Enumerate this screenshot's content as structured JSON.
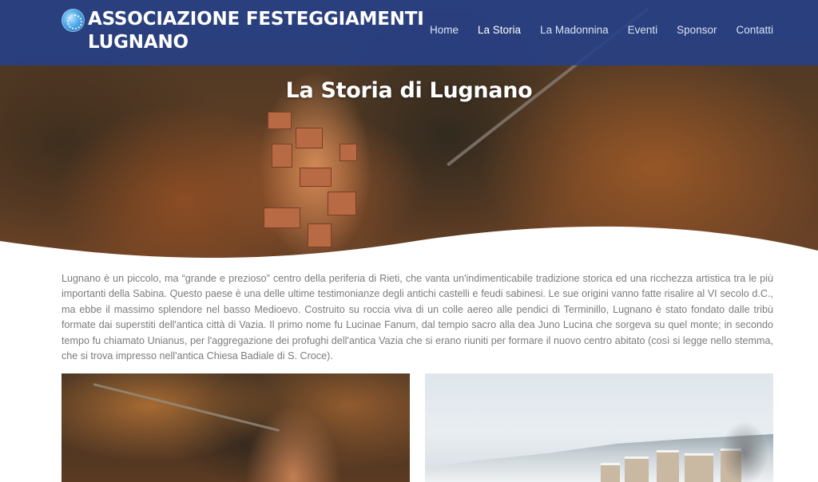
{
  "brand": {
    "title": "ASSOCIAZIONE FESTEGGIAMENTI LUGNANO",
    "logo_icon": "rosette-logo-icon"
  },
  "nav": {
    "items": [
      {
        "label": "Home",
        "active": false
      },
      {
        "label": "La Storia",
        "active": true
      },
      {
        "label": "La Madonnina",
        "active": false
      },
      {
        "label": "Eventi",
        "active": false
      },
      {
        "label": "Sponsor",
        "active": false
      },
      {
        "label": "Contatti",
        "active": false
      }
    ]
  },
  "hero": {
    "title": "La Storia di Lugnano"
  },
  "content": {
    "intro": "Lugnano è un piccolo, ma “grande e prezioso” centro della periferia di Rieti, che vanta un'indimenticabile tradizione storica ed una ricchezza artistica tra le più importanti della Sabina. Questo paese è una delle ultime testimonianze degli antichi castelli e feudi sabinesi. Le sue origini vanno fatte risalire al VI secolo d.C., ma ebbe il massimo splendore nel basso Medioevo. Costruito su roccia viva di un colle aereo alle pendici di Terminillo, Lugnano è stato fondato dalle tribù formate dai superstiti dell'antica città di Vazia. Il primo nome fu Lucinae Fanum, dal tempio sacro alla dea Juno Lucina che sorgeva su quel monte; in secondo tempo fu chiamato Unianus, per l'aggregazione dei profughi dell'antica Vazia che si erano riuniti per formare il nuovo centro abitato (così si legge nello stemma, che si trova impresso nell'antica Chiesa Badiale di S. Croce)."
  },
  "colors": {
    "navbar": "#25408a",
    "nav_text": "#d9e3f5",
    "body_text": "#7b7b7b"
  }
}
